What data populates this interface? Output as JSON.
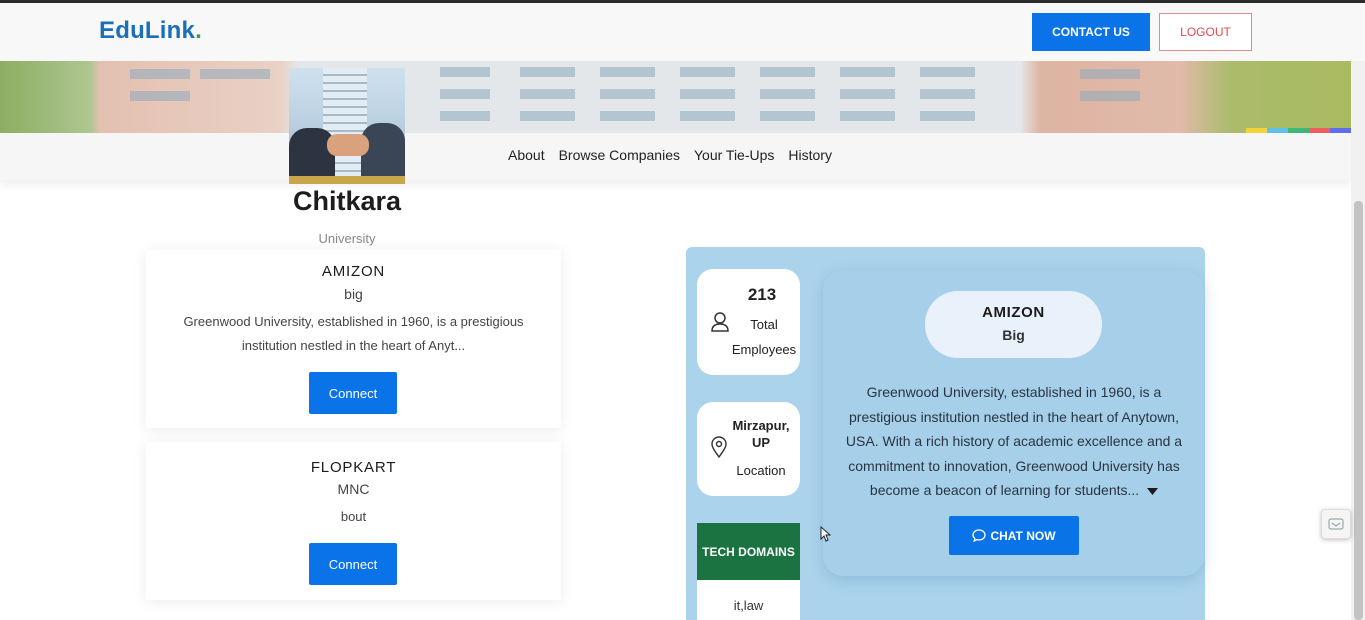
{
  "header": {
    "brand": "EduLink",
    "brand_dot": ".",
    "contact_label": "CONTACT US",
    "logout_label": "LOGOUT"
  },
  "subnav": {
    "items": [
      "About",
      "Browse Companies",
      "Your Tie-Ups",
      "History"
    ]
  },
  "profile": {
    "name": "Chitkara",
    "type": "University"
  },
  "companies": [
    {
      "name": "AMIZON",
      "size": "big",
      "description": "Greenwood University, established in 1960, is a prestigious institution nestled in the heart of Anyt...",
      "button": "Connect"
    },
    {
      "name": "FLOPKART",
      "size": "MNC",
      "description": "bout",
      "button": "Connect"
    }
  ],
  "detail": {
    "employees_count": "213",
    "employees_label_1": "Total",
    "employees_label_2": "Employees",
    "location_value": "Mirzapur, UP",
    "location_label": "Location",
    "tech_header": "TECH DOMAINS",
    "tech_value": "it,law",
    "company_name": "AMIZON",
    "company_size": "Big",
    "description": "Greenwood University, established in 1960, is a prestigious institution nestled in the heart of Anytown, USA. With a rich history of academic excellence and a commitment to innovation, Greenwood University has become a beacon of learning for students...",
    "chat_label": "CHAT NOW"
  },
  "icons": {
    "user": "user-icon",
    "location": "location-pin-icon",
    "expand": "caret-down-icon",
    "chat": "chat-bubble-icon",
    "widget": "chat-widget-icon"
  },
  "colors": {
    "primary": "#0a73e8",
    "brand": "#1a6fb8",
    "brand_dot": "#2e9e5a",
    "logout": "#dc4b4b",
    "tech_header": "#1a7340",
    "panel": "#abd3ec"
  }
}
